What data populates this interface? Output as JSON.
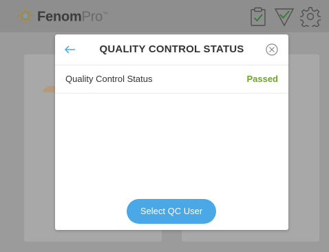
{
  "app": {
    "logo_strong": "Fenom",
    "logo_light": "Pro",
    "logo_tm": "™"
  },
  "header": {
    "icons": [
      "clipboard-check-icon",
      "funnel-check-icon",
      "gear-icon"
    ]
  },
  "modal": {
    "title": "QUALITY CONTROL STATUS",
    "back_icon": "arrow-left-icon",
    "close_icon": "close-circle-icon",
    "status_label": "Quality Control Status",
    "status_value": "Passed",
    "action_label": "Select QC User"
  },
  "colors": {
    "accent": "#4aa8e6",
    "status_passed": "#6da42a",
    "overlay": "#9b9b9b"
  }
}
